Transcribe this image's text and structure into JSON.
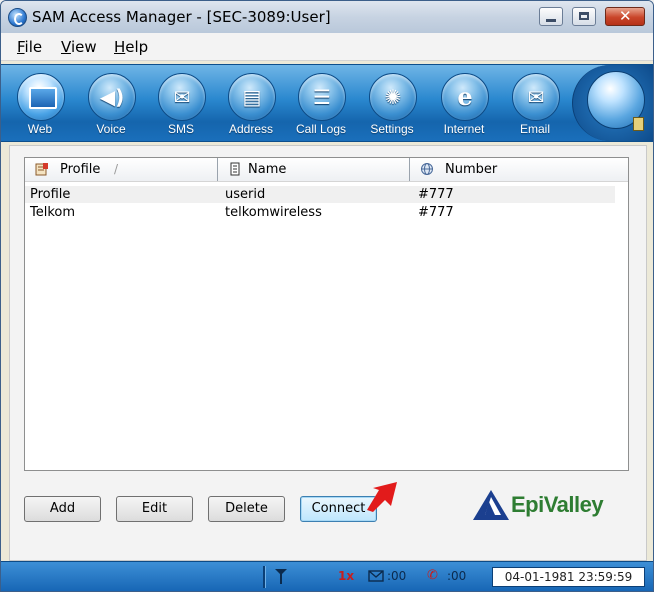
{
  "window": {
    "title": "SAM Access Manager - [SEC-3089:User]",
    "close_glyph": "✕"
  },
  "menu": [
    "File",
    "View",
    "Help"
  ],
  "toolbar": [
    {
      "label": "Web",
      "icon": "web-icon",
      "glyph": "",
      "active": true
    },
    {
      "label": "Voice",
      "icon": "speaker-icon",
      "glyph": "◀)"
    },
    {
      "label": "SMS",
      "icon": "envelope-icon",
      "glyph": "✉"
    },
    {
      "label": "Address",
      "icon": "address-book-icon",
      "glyph": "▤"
    },
    {
      "label": "Call Logs",
      "icon": "call-logs-icon",
      "glyph": "☰"
    },
    {
      "label": "Settings",
      "icon": "gear-icon",
      "glyph": "✺"
    },
    {
      "label": "Internet",
      "icon": "internet-explorer-icon",
      "glyph": "e"
    },
    {
      "label": "Email",
      "icon": "email-icon",
      "glyph": "✉"
    }
  ],
  "list": {
    "columns": [
      "Profile",
      "Name",
      "Number"
    ],
    "sort_indicator": "/",
    "rows": [
      {
        "profile": "Profile",
        "name": "userid",
        "number": "#777"
      },
      {
        "profile": "Telkom",
        "name": "telkomwireless",
        "number": "#777"
      }
    ]
  },
  "buttons": {
    "add": "Add",
    "edit": "Edit",
    "delete": "Delete",
    "connect": "Connect"
  },
  "logo": {
    "text": "EpiValley"
  },
  "status": {
    "network": "1x",
    "sms_count": ":00",
    "call_count": ":00",
    "datetime": "04-01-1981 23:59:59"
  },
  "colors": {
    "toolbar": "#2a88cf",
    "logo_green": "#2e7d32",
    "logo_blue": "#1b3f8f",
    "arrow": "#e21b1b"
  }
}
